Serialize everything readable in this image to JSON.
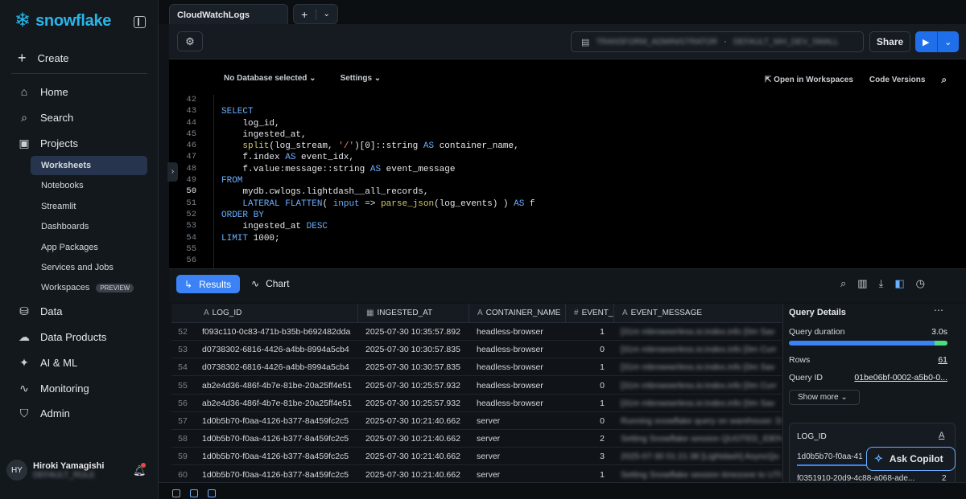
{
  "sidebar": {
    "logo": "snowflake",
    "create": "Create",
    "nav": [
      {
        "label": "Home",
        "icon": "home-icon"
      },
      {
        "label": "Search",
        "icon": "search-icon"
      },
      {
        "label": "Projects",
        "icon": "projects-icon"
      }
    ],
    "sub": [
      "Worksheets",
      "Notebooks",
      "Streamlit",
      "Dashboards",
      "App Packages",
      "Services and Jobs",
      "Workspaces"
    ],
    "preview_badge": "PREVIEW",
    "nav2": [
      {
        "label": "Data",
        "icon": "database-icon"
      },
      {
        "label": "Data Products",
        "icon": "cloud-icon"
      },
      {
        "label": "AI & ML",
        "icon": "sparkle-icon"
      },
      {
        "label": "Monitoring",
        "icon": "monitoring-icon"
      },
      {
        "label": "Admin",
        "icon": "shield-icon"
      }
    ],
    "user": {
      "initials": "HY",
      "name": "Hiroki Yamagishi",
      "role": "DEFAULT_ROLE"
    }
  },
  "tabs": {
    "active": "CloudWatchLogs"
  },
  "toolbar": {
    "context_role": "TRANSFORM_ADMINISTRATOR",
    "context_wh": "DEFAULT_WH_DEV_SMALL",
    "share": "Share"
  },
  "editor": {
    "no_db": "No Database selected",
    "settings": "Settings",
    "open_ws": "Open in Workspaces",
    "code_versions": "Code Versions",
    "line_numbers": [
      "42",
      "43",
      "44",
      "45",
      "46",
      "47",
      "48",
      "49",
      "50",
      "51",
      "52",
      "53",
      "54",
      "55",
      "56"
    ],
    "lines": [
      "",
      "SELECT",
      "    log_id,",
      "    ingested_at,",
      "    split(log_stream, '/')[0]::string AS container_name,",
      "    f.index AS event_idx,",
      "    f.value:message::string AS event_message",
      "FROM",
      "    mydb.cwlogs.lightdash__all_records,",
      "    LATERAL FLATTEN( input => parse_json(log_events) ) AS f",
      "ORDER BY",
      "    ingested_at DESC",
      "LIMIT 1000;",
      "",
      ""
    ]
  },
  "results": {
    "results_label": "Results",
    "chart_label": "Chart",
    "columns": [
      "LOG_ID",
      "INGESTED_AT",
      "CONTAINER_NAME",
      "EVENT_",
      "EVENT_MESSAGE"
    ],
    "rows": [
      {
        "n": "52",
        "log_id": "f093c110-0c83-471b-b35b-b692482dda",
        "ingested_at": "2025-07-30 10:35:57.892",
        "container": "headless-browser",
        "idx": "1",
        "msg": "[31m mbrowserless.io:index.info [0m Sav"
      },
      {
        "n": "53",
        "log_id": "d0738302-6816-4426-a4bb-8994a5cb4",
        "ingested_at": "2025-07-30 10:30:57.835",
        "container": "headless-browser",
        "idx": "0",
        "msg": "[31m mbrowserless.io:index.info [0m Curr"
      },
      {
        "n": "54",
        "log_id": "d0738302-6816-4426-a4bb-8994a5cb4",
        "ingested_at": "2025-07-30 10:30:57.835",
        "container": "headless-browser",
        "idx": "1",
        "msg": "[31m mbrowserless.io:index.info [0m Sav"
      },
      {
        "n": "55",
        "log_id": "ab2e4d36-486f-4b7e-81be-20a25ff4e51",
        "ingested_at": "2025-07-30 10:25:57.932",
        "container": "headless-browser",
        "idx": "0",
        "msg": "[31m mbrowserless.io:index.info [0m Curr"
      },
      {
        "n": "56",
        "log_id": "ab2e4d36-486f-4b7e-81be-20a25ff4e51",
        "ingested_at": "2025-07-30 10:25:57.932",
        "container": "headless-browser",
        "idx": "1",
        "msg": "[31m mbrowserless.io:index.info [0m Sav"
      },
      {
        "n": "57",
        "log_id": "1d0b5b70-f0aa-4126-b377-8a459fc2c5",
        "ingested_at": "2025-07-30 10:21:40.662",
        "container": "server",
        "idx": "0",
        "msg": "Running snowflake query on warehouse: DE"
      },
      {
        "n": "58",
        "log_id": "1d0b5b70-f0aa-4126-b377-8a459fc2c5",
        "ingested_at": "2025-07-30 10:21:40.662",
        "container": "server",
        "idx": "2",
        "msg": "Setting Snowflake session QUOTED_IDENTIF"
      },
      {
        "n": "59",
        "log_id": "1d0b5b70-f0aa-4126-b377-8a459fc2c5",
        "ingested_at": "2025-07-30 10:21:40.662",
        "container": "server",
        "idx": "3",
        "msg": "2025-07-30 01:21:38 [Lightdash] AsyncQu"
      },
      {
        "n": "60",
        "log_id": "1d0b5b70-f0aa-4126-b377-8a459fc2c5",
        "ingested_at": "2025-07-30 10:21:40.662",
        "container": "server",
        "idx": "1",
        "msg": "Setting Snowflake session timezone to UTC"
      }
    ]
  },
  "query_details": {
    "title": "Query Details",
    "duration_label": "Query duration",
    "duration": "3.0s",
    "duration_fraction": 0.92,
    "rows_label": "Rows",
    "rows": "61",
    "qid_label": "Query ID",
    "qid": "01be06bf-0002-a5b0-0...",
    "show_more": "Show more",
    "card_title": "LOG_ID",
    "card_v1": "1d0b5b70-f0aa-41",
    "card_v2": "f0351910-20d9-4c88-a068-ade...",
    "card_n2": "2",
    "copilot": "Ask Copilot"
  },
  "colors": {
    "accent": "#3b82f6",
    "brand": "#29b5e8"
  }
}
